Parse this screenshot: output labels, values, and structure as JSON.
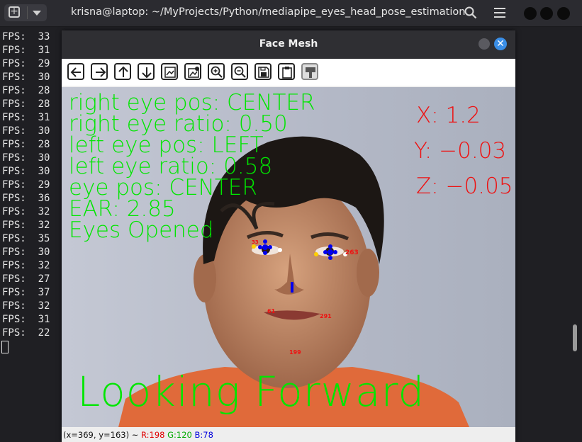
{
  "terminal": {
    "title": "krisna@laptop: ~/MyProjects/Python/mediapipe_eyes_head_pose_estimation",
    "fps_label": "FPS:",
    "fps_values": [
      "33",
      "31",
      "29",
      "30",
      "28",
      "28",
      "31",
      "30",
      "28",
      "30",
      "30",
      "29",
      "36",
      "32",
      "32",
      "35",
      "30",
      "32",
      "27",
      "37",
      "32",
      "31",
      "22"
    ]
  },
  "window": {
    "title": "Face Mesh",
    "toolbar": [
      {
        "name": "pan-left-icon"
      },
      {
        "name": "pan-right-icon"
      },
      {
        "name": "pan-up-icon"
      },
      {
        "name": "pan-down-icon"
      },
      {
        "name": "zoom-fit-icon"
      },
      {
        "name": "zoom-original-icon"
      },
      {
        "name": "zoom-in-icon"
      },
      {
        "name": "zoom-out-icon"
      },
      {
        "name": "save-icon"
      },
      {
        "name": "copy-clipboard-icon"
      },
      {
        "name": "properties-icon"
      }
    ]
  },
  "overlay": {
    "lines": [
      "right eye pos: CENTER",
      "right eye ratio: 0.50",
      "left eye pos: LEFT",
      "left eye ratio: 0.58",
      "eye pos: CENTER",
      "EAR: 2.85",
      "Eyes Opened"
    ],
    "x_label": "X: 1.2",
    "y_label": "Y: -0.03",
    "z_label": "Z: -0.05",
    "direction": "Looking Forward",
    "landmarks": {
      "l61": "61",
      "l291": "291",
      "l199": "199",
      "l263": "263",
      "l33": "33"
    },
    "colors": {
      "text": "#00e600",
      "axis": "#ee1111",
      "iris": "#0000ee",
      "corner_yellow": "#ffd000"
    }
  },
  "status": {
    "coords": "(x=369, y=163) ~",
    "r": "R:198",
    "g": "G:120",
    "b": "B:78"
  }
}
